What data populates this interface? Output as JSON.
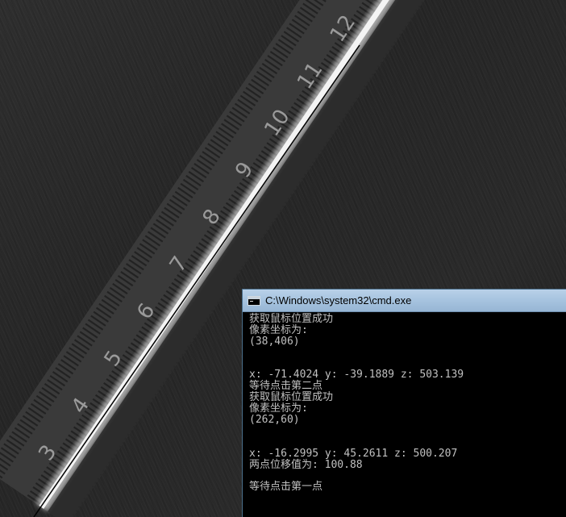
{
  "window": {
    "title": "C:\\Windows\\system32\\cmd.exe",
    "icon": "console-icon"
  },
  "console": {
    "lines": [
      "获取鼠标位置成功",
      "像素坐标为:",
      "(38,406)",
      "",
      "",
      "x: -71.4024 y: -39.1889 z: 503.139",
      "等待点击第二点",
      "获取鼠标位置成功",
      "像素坐标为:",
      "(262,60)",
      "",
      "",
      "x: -16.2995 y: 45.2611 z: 500.207",
      "两点位移值为: 100.88",
      "",
      "等待点击第一点"
    ]
  },
  "ruler": {
    "numbers": [
      "3",
      "4",
      "5",
      "6",
      "7",
      "8",
      "9",
      "10",
      "11",
      "12"
    ]
  },
  "colors": {
    "terminal_bg": "#000000",
    "terminal_text": "#c0c0c0",
    "titlebar": "#a6c3df"
  }
}
